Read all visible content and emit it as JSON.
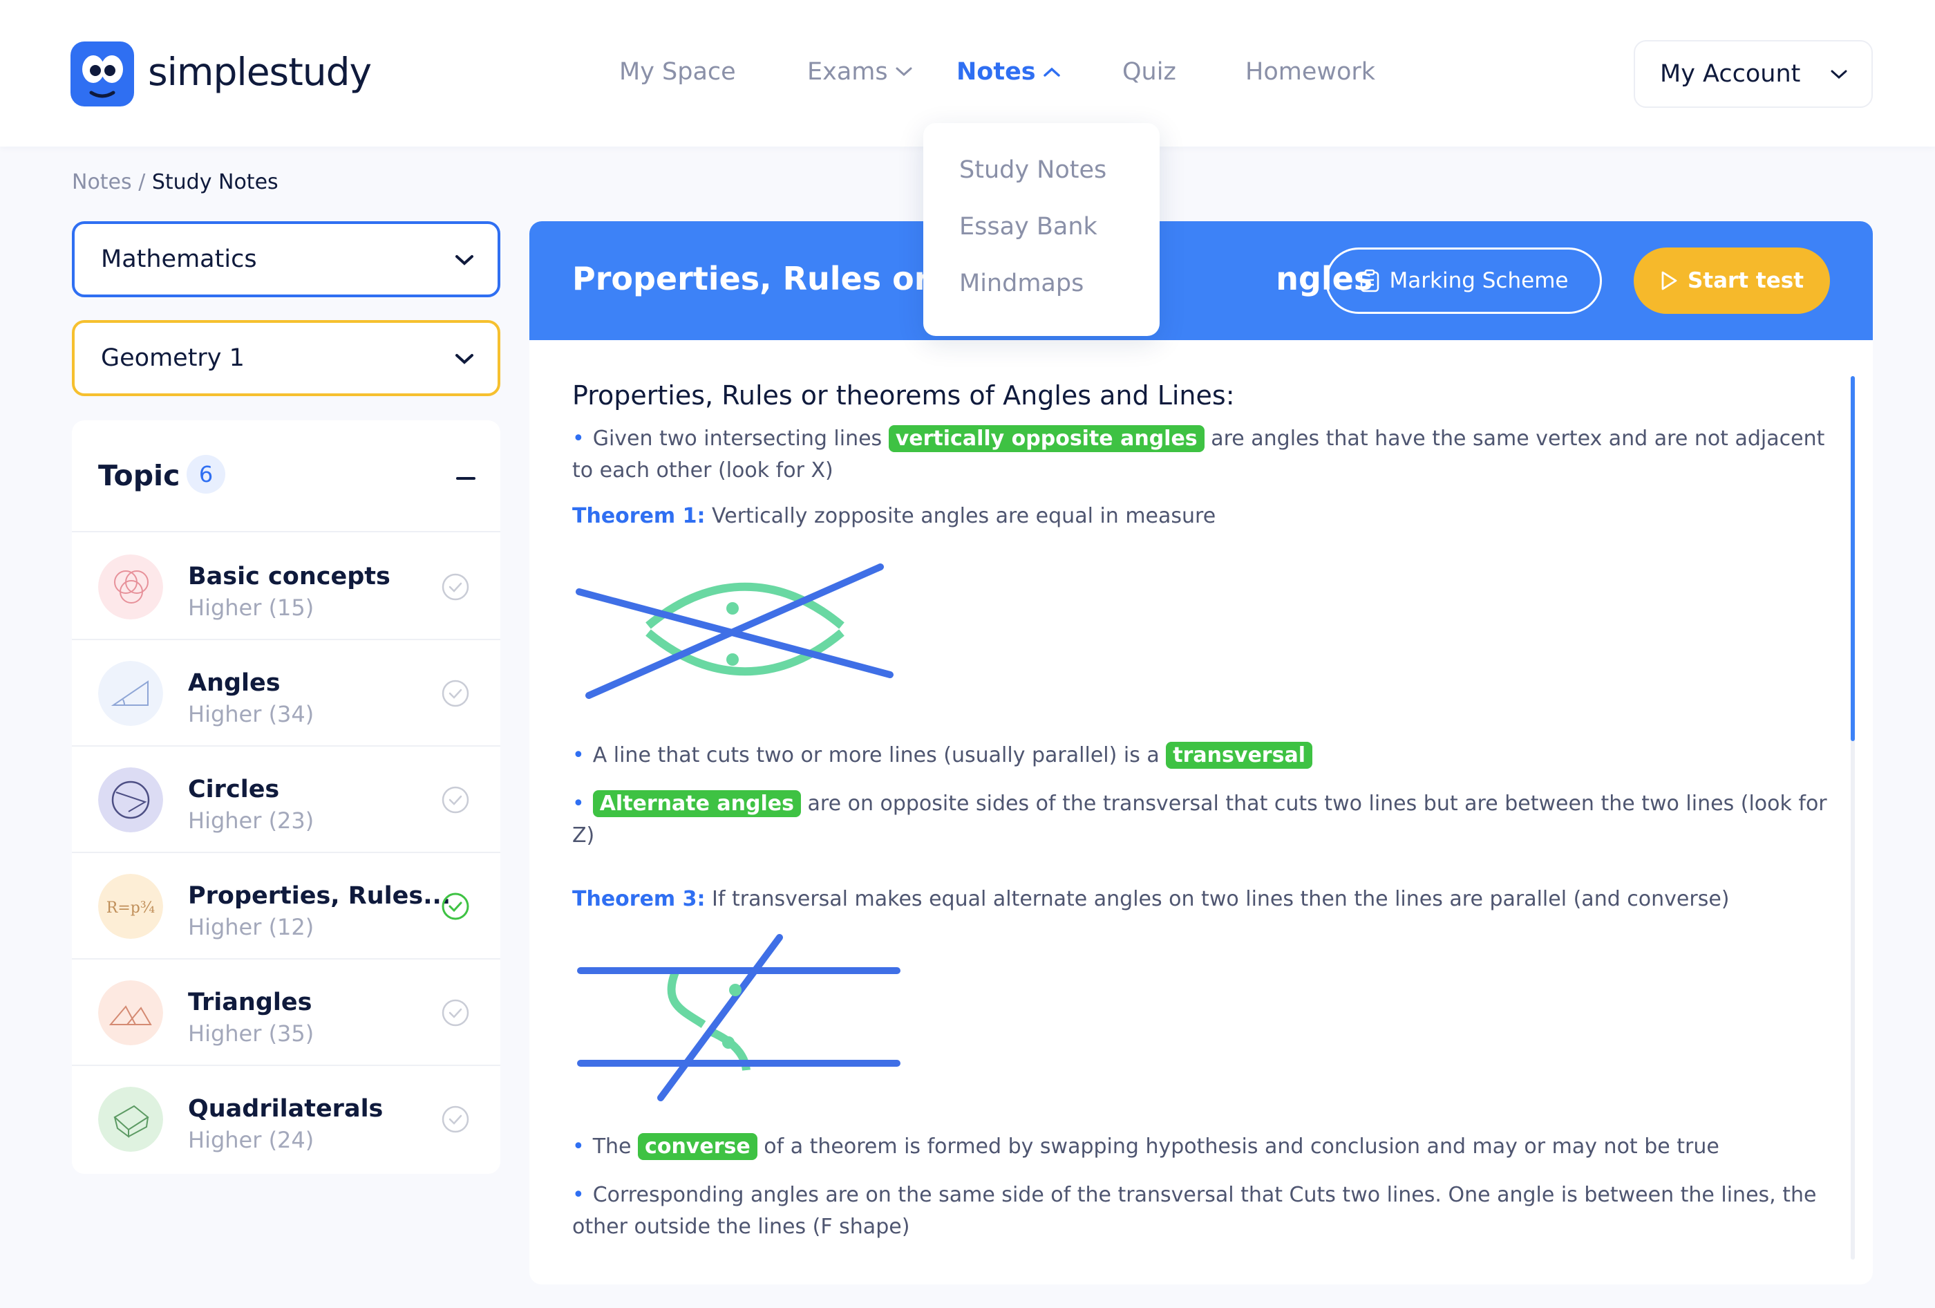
{
  "header": {
    "logo_text": "simplestudy",
    "nav": [
      {
        "label": "My Space"
      },
      {
        "label": "Exams"
      },
      {
        "label": "Notes"
      },
      {
        "label": "Quiz"
      },
      {
        "label": "Homework"
      }
    ],
    "account_label": "My Account"
  },
  "notes_dropdown": {
    "items": [
      "Study Notes",
      "Essay Bank",
      "Mindmaps"
    ]
  },
  "breadcrumb": {
    "root": "Notes",
    "separator": "/",
    "current": "Study Notes"
  },
  "selectors": {
    "subject": "Mathematics",
    "topic": "Geometry 1"
  },
  "topics": {
    "title": "Topic",
    "count": "6",
    "items": [
      {
        "name": "Basic concepts",
        "sub": "Higher (15)",
        "icon": "venn-icon",
        "done": false
      },
      {
        "name": "Angles",
        "sub": "Higher (34)",
        "icon": "angle-icon",
        "done": false
      },
      {
        "name": "Circles",
        "sub": "Higher (23)",
        "icon": "circle-icon",
        "done": false
      },
      {
        "name": "Properties, Rules...",
        "sub": "Higher (12)",
        "icon": "formula-icon",
        "done": true
      },
      {
        "name": "Triangles",
        "sub": "Higher (35)",
        "icon": "triangle-icon",
        "done": false
      },
      {
        "name": "Quadrilaterals",
        "sub": "Higher (24)",
        "icon": "cube-icon",
        "done": false
      }
    ]
  },
  "main": {
    "banner_title_left": "Properties, Rules or th",
    "banner_title_right": "ngles",
    "marking_scheme_label": "Marking Scheme",
    "start_test_label": "Start test",
    "heading": "Properties, Rules or theorems of Angles and Lines:",
    "p1_before": "Given two intersecting lines",
    "p1_highlight": "vertically opposite angles",
    "p1_after": "are angles that have the same vertex and are not adjacent to each other (look for X)",
    "t1_label": "Theorem 1:",
    "t1_text": "Vertically zopposite angles are equal in measure",
    "p2_before": "A line that cuts two or more lines (usually parallel) is a",
    "p2_highlight": "transversal",
    "p3_highlight": "Alternate angles",
    "p3_after": "are on opposite sides of the transversal that cuts two lines but are between the two lines (look for Z)",
    "t3_label": "Theorem 3:",
    "t3_text": "If transversal makes equal alternate angles on two lines then the lines are parallel (and converse)",
    "p4_before": "The",
    "p4_highlight": "converse",
    "p4_after": "of a theorem is formed by swapping hypothesis and conclusion and may or may not be true",
    "p5": "Corresponding angles are on the same side of the transversal that Cuts two lines. One angle is between the lines, the other outside the lines (F shape)"
  },
  "colors": {
    "accent": "#2f6ff2",
    "banner": "#3d82f7",
    "highlight": "#3ec243",
    "start_button": "#f6b92b",
    "topic_border": "#f6c02f"
  }
}
